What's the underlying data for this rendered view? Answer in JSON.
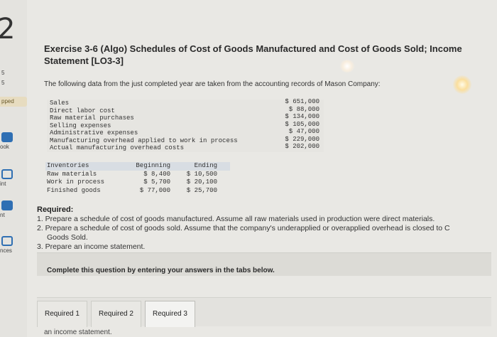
{
  "sidebar": {
    "question_number": "2",
    "small_a": "5",
    "small_b": "5",
    "badge": "pped",
    "items": [
      "ook",
      "int",
      "nt",
      "nces"
    ]
  },
  "exercise": {
    "title": "Exercise 3-6 (Algo) Schedules of Cost of Goods Manufactured and Cost of Goods Sold; Income Statement [LO3-3]",
    "intro": "The following data from the just completed year are taken from the accounting records of Mason Company:"
  },
  "data_table": {
    "rows": [
      {
        "label": "Sales",
        "value": "$ 651,000"
      },
      {
        "label": "Direct labor cost",
        "value": "$ 88,000"
      },
      {
        "label": "Raw material purchases",
        "value": "$ 134,000"
      },
      {
        "label": "Selling expenses",
        "value": "$ 105,000"
      },
      {
        "label": "Administrative expenses",
        "value": "$ 47,000"
      },
      {
        "label": "Manufacturing overhead applied to work in process",
        "value": "$ 229,000"
      },
      {
        "label": "Actual manufacturing overhead costs",
        "value": "$ 202,000"
      }
    ]
  },
  "inventory_table": {
    "header": {
      "label": "Inventories",
      "begin": "Beginning",
      "end": "Ending"
    },
    "rows": [
      {
        "label": "Raw materials",
        "begin": "$ 8,400",
        "end": "$ 10,500"
      },
      {
        "label": "Work in process",
        "begin": "$ 5,700",
        "end": "$ 20,100"
      },
      {
        "label": "Finished goods",
        "begin": "$ 77,000",
        "end": "$ 25,700"
      }
    ]
  },
  "required": {
    "title": "Required:",
    "items": [
      "1. Prepare a schedule of cost of goods manufactured. Assume all raw materials used in production were direct materials.",
      "2. Prepare a schedule of cost of goods sold. Assume that the company's underapplied or overapplied overhead is closed to C",
      "Goods Sold.",
      "3. Prepare an income statement."
    ]
  },
  "complete_prompt": "Complete this question by entering your answers in the tabs below.",
  "tabs": [
    "Required 1",
    "Required 2",
    "Required 3"
  ],
  "bottom_text": "an income statement."
}
